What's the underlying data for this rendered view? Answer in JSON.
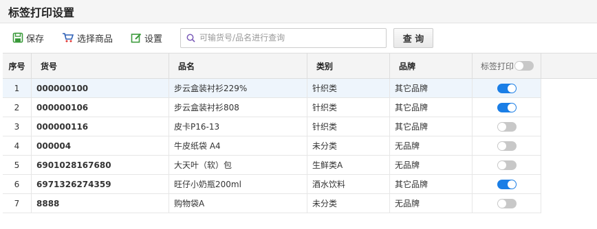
{
  "header": {
    "title": "标签打印设置"
  },
  "toolbar": {
    "save_label": "保存",
    "select_label": "选择商品",
    "settings_label": "设置",
    "search_placeholder": "可输货号/品名进行查询",
    "query_label": "查 询"
  },
  "table": {
    "columns": [
      "序号",
      "货号",
      "品名",
      "类别",
      "品牌",
      "标签打印"
    ],
    "header_toggle": false,
    "rows": [
      {
        "index": "1",
        "code": "000000100",
        "name": "步云盒装衬衫229%",
        "category": "针织类",
        "brand": "其它品牌",
        "print": true
      },
      {
        "index": "2",
        "code": "000000106",
        "name": "步云盒装衬衫808",
        "category": "针织类",
        "brand": "其它品牌",
        "print": true
      },
      {
        "index": "3",
        "code": "000000116",
        "name": "皮卡P16-13",
        "category": "针织类",
        "brand": "其它品牌",
        "print": false
      },
      {
        "index": "4",
        "code": "000004",
        "name": "牛皮纸袋 A4",
        "category": "未分类",
        "brand": "无品牌",
        "print": false
      },
      {
        "index": "5",
        "code": "6901028167680",
        "name": "大天叶（软）包",
        "category": "生鲜类A",
        "brand": "无品牌",
        "print": false
      },
      {
        "index": "6",
        "code": "6971326274359",
        "name": "旺仔小奶瓶200ml",
        "category": "酒水饮料",
        "brand": "其它品牌",
        "print": true
      },
      {
        "index": "7",
        "code": "8888",
        "name": "购物袋A",
        "category": "未分类",
        "brand": "无品牌",
        "print": false
      }
    ]
  },
  "colors": {
    "accent": "#1a7ee6",
    "code_text": "#2d6ea3",
    "selected_row": "#eef5fc",
    "save_icon": "#3a9a3a",
    "cart_icon": "#2b5fb5"
  }
}
